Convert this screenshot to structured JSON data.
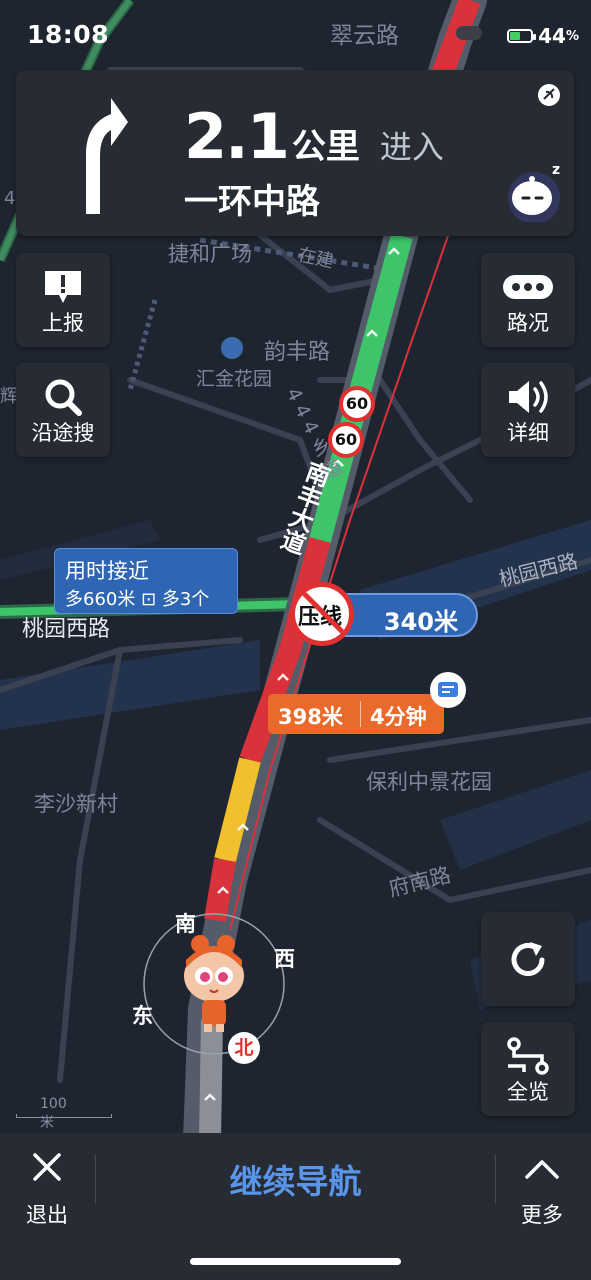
{
  "status_bar": {
    "time": "18:08",
    "battery": "44",
    "battery_unit": "%"
  },
  "guidance": {
    "distance_value": "2.1",
    "distance_unit": "公里",
    "action": "进入",
    "road_name": "一环中路"
  },
  "left_buttons": [
    {
      "label": "上报",
      "icon": "report-exclamation-icon"
    },
    {
      "label": "沿途搜",
      "icon": "search-icon"
    }
  ],
  "right_buttons": [
    {
      "label": "路况",
      "icon": "traffic-dots-icon"
    },
    {
      "label": "详细",
      "icon": "speaker-icon"
    },
    {
      "label": "",
      "icon": "refresh-icon"
    },
    {
      "label": "全览",
      "icon": "route-overview-icon"
    }
  ],
  "map_labels": {
    "cuiyun": "翠云路",
    "jiehe": "捷和广场",
    "zaijian": "在建",
    "yunfeng": "韵丰路",
    "huijin": "汇金花园",
    "road444": "4 4 4 乡 道",
    "nanfeng": "南丰大道",
    "taoyuan_left": "桃园西路",
    "taoyuan_right": "桃园西路",
    "lisha": "李沙新村",
    "baoli": "保利中景花园",
    "funan": "府南路",
    "edge_left1": "4",
    "edge_left2": "辉"
  },
  "speed_limits": [
    "60",
    "60"
  ],
  "time_callout": {
    "line1": "用时接近",
    "line2": "多660米 ⊡ 多3个"
  },
  "press_line_warning": {
    "sign_text": "压线",
    "distance": "340米"
  },
  "congestion": {
    "distance": "398米",
    "duration": "4分钟"
  },
  "compass": {
    "north": "北",
    "south": "南",
    "east": "东",
    "west": "西"
  },
  "scale": "100米",
  "bottom_bar": {
    "exit_label": "退出",
    "continue_label": "继续导航",
    "more_label": "更多"
  },
  "colors": {
    "route_green": "#3ec56a",
    "route_red": "#d9323a",
    "route_yellow": "#f2c02e",
    "accent_blue": "#2f66b4"
  }
}
